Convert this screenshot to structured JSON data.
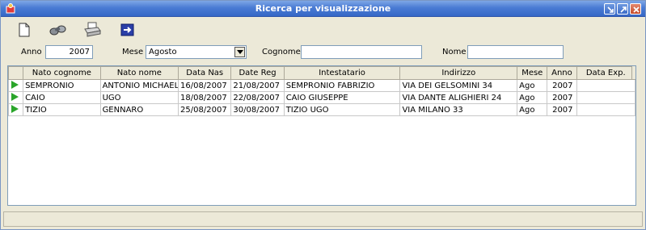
{
  "window": {
    "title": "Ricerca per visualizzazione"
  },
  "toolbar": {
    "icons": [
      "new-document-icon",
      "binoculars-search-icon",
      "printer-icon",
      "exit-arrow-icon"
    ]
  },
  "filters": {
    "anno_label": "Anno",
    "anno_value": "2007",
    "mese_label": "Mese",
    "mese_value": "Agosto",
    "cognome_label": "Cognome",
    "cognome_value": "",
    "nome_label": "Nome",
    "nome_value": ""
  },
  "table": {
    "columns": [
      "Nato cognome",
      "Nato nome",
      "Data Nas",
      "Date Reg",
      "Intestatario",
      "Indirizzo",
      "Mese",
      "Anno",
      "Data Exp."
    ],
    "rows": [
      [
        "SEMPRONIO",
        "ANTONIO MICHAEL",
        "16/08/2007",
        "21/08/2007",
        "SEMPRONIO FABRIZIO",
        "VIA DEI GELSOMINI 34",
        "Ago",
        "2007",
        ""
      ],
      [
        "CAIO",
        "UGO",
        "18/08/2007",
        "22/08/2007",
        "CAIO GIUSEPPE",
        "VIA DANTE ALIGHIERI 24",
        "Ago",
        "2007",
        ""
      ],
      [
        "TIZIO",
        "GENNARO",
        "25/08/2007",
        "30/08/2007",
        "TIZIO UGO",
        "VIA MILANO 33",
        "Ago",
        "2007",
        ""
      ]
    ]
  },
  "colors": {
    "title_gradient_top": "#7ea7e6",
    "title_gradient_bottom": "#3567c6",
    "row_indicator": "#2aa52a",
    "window_bg": "#ece9d8"
  }
}
